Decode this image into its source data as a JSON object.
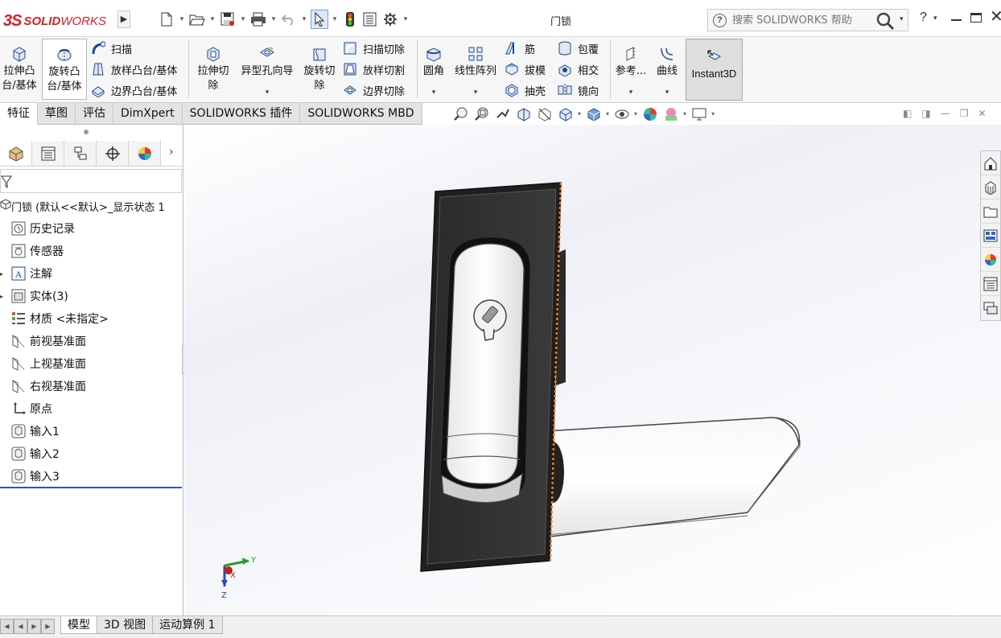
{
  "app": {
    "logo": {
      "ds": "3S",
      "brand_bold": "SOLID",
      "brand_regular": "WORKS"
    },
    "document_title": "门锁",
    "help_search": {
      "placeholder": "搜索 SOLIDWORKS 帮助"
    },
    "help_label": "?"
  },
  "quick_access": [
    "new-document-icon",
    "open-icon",
    "save-icon",
    "print-icon",
    "undo-icon",
    "select-icon",
    "rebuild-icon",
    "file-properties-icon",
    "options-icon"
  ],
  "ribbon": {
    "extrude_boss": "拉伸凸\n台/基体",
    "revolve_boss": "旋转凸\n台/基体",
    "sweep": "扫描",
    "loft_boss": "放样凸台/基体",
    "boundary_boss": "边界凸台/基体",
    "extrude_cut": "拉伸切\n除",
    "hole_wizard": "异型孔向导",
    "revolve_cut": "旋转切\n除",
    "swept_cut": "扫描切除",
    "lofted_cut": "放样切割",
    "boundary_cut": "边界切除",
    "fillet": "圆角",
    "linear_pattern": "线性阵列",
    "rib": "筋",
    "draft": "拔模",
    "shell": "抽壳",
    "wrap": "包覆",
    "intersect": "相交",
    "mirror": "镜向",
    "reference": "参考...",
    "curves": "曲线",
    "instant3d": "Instant3D"
  },
  "tabs": [
    {
      "label": "特征",
      "active": true
    },
    {
      "label": "草图",
      "active": false
    },
    {
      "label": "评估",
      "active": false
    },
    {
      "label": "DimXpert",
      "active": false
    },
    {
      "label": "SOLIDWORKS 插件",
      "active": false
    },
    {
      "label": "SOLIDWORKS MBD",
      "active": false
    }
  ],
  "feature_tree": {
    "root": "门锁  (默认<<默认>_显示状态 1",
    "items": [
      {
        "label": "历史记录",
        "icon": "history-icon"
      },
      {
        "label": "传感器",
        "icon": "sensor-icon"
      },
      {
        "label": "注解",
        "icon": "annotation-icon"
      },
      {
        "label": "实体(3)",
        "icon": "solid-bodies-icon"
      },
      {
        "label": "材质 <未指定>",
        "icon": "material-icon"
      },
      {
        "label": "前视基准面",
        "icon": "plane-icon"
      },
      {
        "label": "上视基准面",
        "icon": "plane-icon"
      },
      {
        "label": "右视基准面",
        "icon": "plane-icon"
      },
      {
        "label": "原点",
        "icon": "origin-icon"
      },
      {
        "label": "输入1",
        "icon": "imported-body-icon"
      },
      {
        "label": "输入2",
        "icon": "imported-body-icon"
      },
      {
        "label": "输入3",
        "icon": "imported-body-icon"
      }
    ]
  },
  "triad": {
    "y": "Y",
    "x": "X",
    "z": "Z"
  },
  "bottom_tabs": [
    {
      "label": "模型",
      "active": true
    },
    {
      "label": "3D 视图",
      "active": false
    },
    {
      "label": "运动算例 1",
      "active": false
    }
  ],
  "colors": {
    "accent_red": "#d32027",
    "selection_blue": "#2b5aa8",
    "highlight_orange": "#f08020"
  }
}
